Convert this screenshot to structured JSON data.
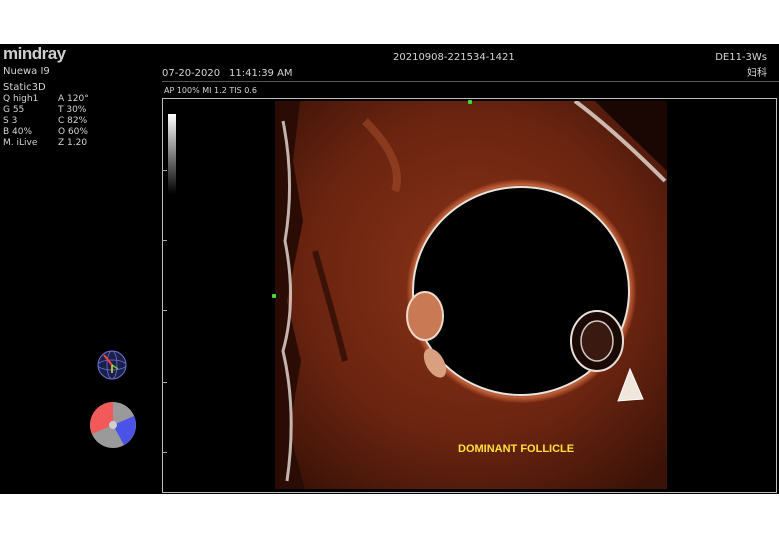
{
  "brand": {
    "logo_text": "mindray",
    "model": "Nuewa I9"
  },
  "header": {
    "exam_id": "20210908-221534-1421",
    "probe": "DE11-3Ws",
    "date": "07-20-2020",
    "time": "11:41:39 AM",
    "department": "妇科"
  },
  "acoustic": "AP 100%  MI 1.2  TIS 0.6",
  "mode_title": "Static3D",
  "params": [
    {
      "left": "Q high1",
      "right": "A 120°"
    },
    {
      "left": "G 55",
      "right": "T 30%"
    },
    {
      "left": "S 3",
      "right": "C 82%"
    },
    {
      "left": "B 40%",
      "right": "O 60%"
    },
    {
      "left": "M. iLive",
      "right": "Z 1.20"
    }
  ],
  "annotation": "DOMINANT FOLLICLE",
  "colors": {
    "background": "#000000",
    "tissue": "#7a2a12",
    "annotation": "#ffe23a",
    "marker": "#3fdc2f",
    "pie_red": "#f25a5a",
    "pie_blue": "#4a52e8"
  },
  "icons": {
    "orientation": "3d-orientation-globe-icon",
    "render_direction": "render-direction-pie-icon"
  }
}
